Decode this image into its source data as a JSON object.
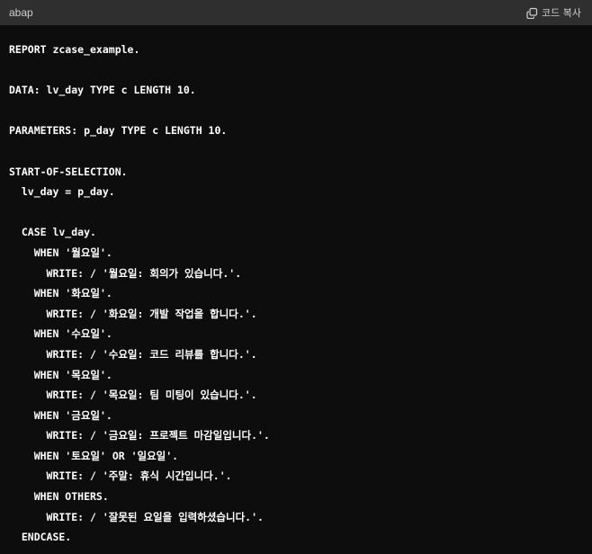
{
  "header": {
    "language": "abap",
    "copy_label": "코드 복사",
    "copy_icon": "copy-icon"
  },
  "code": {
    "lines": [
      "REPORT zcase_example.",
      "",
      "DATA: lv_day TYPE c LENGTH 10.",
      "",
      "PARAMETERS: p_day TYPE c LENGTH 10.",
      "",
      "START-OF-SELECTION.",
      "  lv_day = p_day.",
      "",
      "  CASE lv_day.",
      "    WHEN '월요일'.",
      "      WRITE: / '월요일: 회의가 있습니다.'.",
      "    WHEN '화요일'.",
      "      WRITE: / '화요일: 개발 작업을 합니다.'.",
      "    WHEN '수요일'.",
      "      WRITE: / '수요일: 코드 리뷰를 합니다.'.",
      "    WHEN '목요일'.",
      "      WRITE: / '목요일: 팀 미팅이 있습니다.'.",
      "    WHEN '금요일'.",
      "      WRITE: / '금요일: 프로젝트 마감일입니다.'.",
      "    WHEN '토요일' OR '일요일'.",
      "      WRITE: / '주말: 휴식 시간입니다.'.",
      "    WHEN OTHERS.",
      "      WRITE: / '잘못된 요일을 입력하셨습니다.'.",
      "  ENDCASE."
    ]
  },
  "colors": {
    "background": "#0d0d0d",
    "header_bg": "#2f2f2f",
    "text": "#ffffff"
  }
}
